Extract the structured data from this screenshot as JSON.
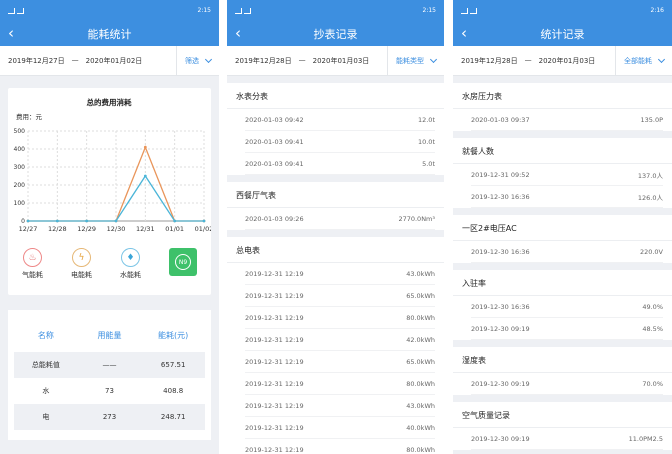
{
  "status": {
    "time1": "2:15",
    "time2": "2:15",
    "time3": "2:16"
  },
  "screen1": {
    "title": "能耗统计",
    "date_from": "2019年12月27日",
    "dash": "—",
    "date_to": "2020年01月02日",
    "filter": "筛选",
    "chart_title": "总的费用消耗",
    "unit_label": "费用：元",
    "energy_buttons": [
      {
        "label": "气能耗",
        "icon": "gas-icon",
        "glyph": "♨"
      },
      {
        "label": "电能耗",
        "icon": "lightning-icon",
        "glyph": "ϟ"
      },
      {
        "label": "水能耗",
        "icon": "water-drop-icon",
        "glyph": "♦"
      },
      {
        "label": "",
        "icon": "total-energy-icon",
        "glyph": "N9"
      }
    ],
    "table_headers": [
      "名称",
      "用能量",
      "能耗(元)"
    ],
    "table_rows": [
      [
        "总能耗值",
        "——",
        "657.51"
      ],
      [
        "水",
        "73",
        "408.8"
      ],
      [
        "电",
        "273",
        "248.71"
      ]
    ]
  },
  "chart_data": {
    "type": "line",
    "title": "总的费用消耗",
    "ylabel": "费用：元",
    "categories": [
      "12/27",
      "12/28",
      "12/29",
      "12/30",
      "12/31",
      "01/01",
      "01/02"
    ],
    "ylim": [
      0,
      500
    ],
    "yticks": [
      "0",
      "100",
      "200",
      "300",
      "400",
      "500"
    ],
    "series": [
      {
        "color": "#e9955a",
        "values": [
          0,
          0,
          0,
          0,
          410,
          0,
          0
        ]
      },
      {
        "color": "#4bb5d8",
        "values": [
          0,
          0,
          0,
          0,
          250,
          0,
          0
        ]
      }
    ]
  },
  "screen2": {
    "title": "抄表记录",
    "date_from": "2019年12月28日",
    "dash": "—",
    "date_to": "2020年01月03日",
    "filter": "能耗类型",
    "sections": [
      {
        "title": "水表分表",
        "records": [
          {
            "time": "2020-01-03 09:42",
            "value": "12.0t"
          },
          {
            "time": "2020-01-03 09:41",
            "value": "10.0t"
          },
          {
            "time": "2020-01-03 09:41",
            "value": "5.0t"
          }
        ]
      },
      {
        "title": "西餐厅气表",
        "records": [
          {
            "time": "2020-01-03 09:26",
            "value": "2770.0Nm³"
          }
        ]
      },
      {
        "title": "总电表",
        "records": [
          {
            "time": "2019-12-31 12:19",
            "value": "43.0kWh"
          },
          {
            "time": "2019-12-31 12:19",
            "value": "65.0kWh"
          },
          {
            "time": "2019-12-31 12:19",
            "value": "80.0kWh"
          },
          {
            "time": "2019-12-31 12:19",
            "value": "42.0kWh"
          },
          {
            "time": "2019-12-31 12:19",
            "value": "65.0kWh"
          },
          {
            "time": "2019-12-31 12:19",
            "value": "80.0kWh"
          },
          {
            "time": "2019-12-31 12:19",
            "value": "43.0kWh"
          },
          {
            "time": "2019-12-31 12:19",
            "value": "40.0kWh"
          },
          {
            "time": "2019-12-31 12:19",
            "value": "80.0kWh"
          }
        ]
      }
    ]
  },
  "screen3": {
    "title": "统计记录",
    "date_from": "2019年12月28日",
    "dash": "—",
    "date_to": "2020年01月03日",
    "filter": "全部能耗",
    "sections": [
      {
        "title": "水房压力表",
        "records": [
          {
            "time": "2020-01-03 09:37",
            "value": "135.0P"
          }
        ]
      },
      {
        "title": "就餐人数",
        "records": [
          {
            "time": "2019-12-31 09:52",
            "value": "137.0人"
          },
          {
            "time": "2019-12-30 16:36",
            "value": "126.0人"
          }
        ]
      },
      {
        "title": "一区2#电压AC",
        "records": [
          {
            "time": "2019-12-30 16:36",
            "value": "220.0V"
          }
        ]
      },
      {
        "title": "入驻率",
        "records": [
          {
            "time": "2019-12-30 16:36",
            "value": "49.0%"
          },
          {
            "time": "2019-12-30 09:19",
            "value": "48.5%"
          }
        ]
      },
      {
        "title": "湿度表",
        "records": [
          {
            "time": "2019-12-30 09:19",
            "value": "70.0%"
          }
        ]
      },
      {
        "title": "空气质量记录",
        "records": [
          {
            "time": "2019-12-30 09:19",
            "value": "11.0PM2.5"
          }
        ]
      }
    ]
  }
}
